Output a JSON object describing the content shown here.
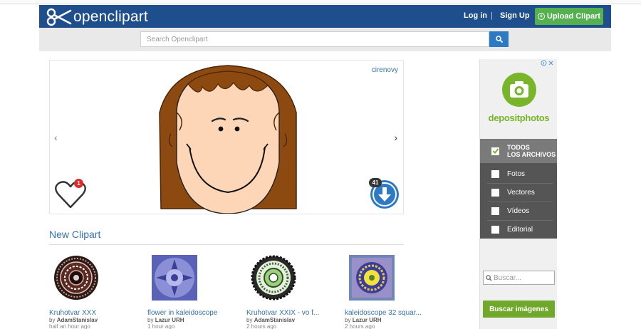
{
  "header": {
    "logo_text": "openclipart",
    "login": "Log in",
    "separator": "|",
    "signup": "Sign Up",
    "upload": "Upload Clipart"
  },
  "search": {
    "placeholder": "Search Openclipart"
  },
  "featured": {
    "author": "cirenovy",
    "arrow_prev": "‹",
    "arrow_next": "›",
    "like_count": "1",
    "download_count": "41"
  },
  "new_clipart": {
    "title": "New Clipart",
    "items": [
      {
        "title": "Kruhotvar XXX",
        "by_prefix": "by",
        "author": "AdamStanislav",
        "time": "half an hour ago"
      },
      {
        "title": "flower in kaleidoscope",
        "by_prefix": "by",
        "author": "Lazur URH",
        "time": "1 hour ago"
      },
      {
        "title": "Kruhotvar XXIX - vo f...",
        "by_prefix": "by",
        "author": "AdamStanislav",
        "time": "2 hours ago"
      },
      {
        "title": "kaleidoscope 32 squar...",
        "by_prefix": "by",
        "author": "Lazur URH",
        "time": "2 hours ago"
      }
    ]
  },
  "ad": {
    "brand": "depositphotos",
    "options": [
      {
        "label_line1": "TODOS",
        "label_line2": "LOS ARCHIVOS"
      },
      {
        "label": "Fotos"
      },
      {
        "label": "Vectores"
      },
      {
        "label": "Vídeos"
      },
      {
        "label": "Editorial"
      }
    ],
    "search_placeholder": "Buscar...",
    "button": "Buscar imágenes"
  },
  "colors": {
    "header_bg": "#1f4e8c",
    "upload_green": "#55b04f",
    "link_blue": "#3572b0",
    "ad_green": "#78b52a"
  }
}
